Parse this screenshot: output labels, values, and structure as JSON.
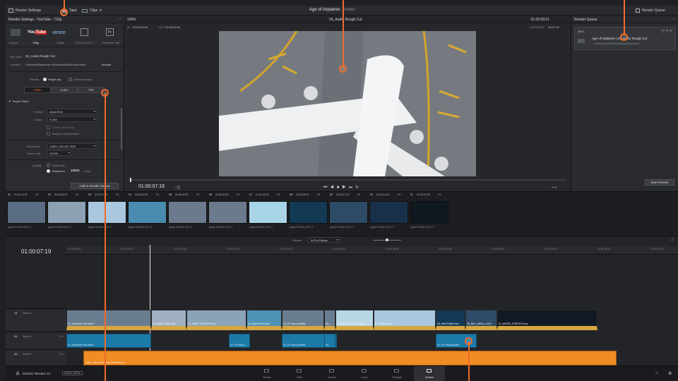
{
  "top": {
    "render_settings": "Render Settings",
    "tape": "Tape",
    "clips": "Clips",
    "project_title": "Age of Airplanes",
    "edited": "Edited",
    "render_queue": "Render Queue"
  },
  "render_settings": {
    "panel_title": "Render Settings - YouTube - 720p",
    "presets": [
      "Custom",
      "720p",
      "1080p",
      "Final Cut Pro 7",
      "Premiere XML"
    ],
    "filename_label": "File name",
    "filename": "04_Audio Rough Cut",
    "location_label": "Location",
    "location": "/Volumes/Macintosh HD/Users/iMac/Documents",
    "browse": "Browse",
    "render_label": "Render",
    "single_clip": "Single clip",
    "individual_clips": "Individual clips",
    "tabs": [
      "Video",
      "Audio",
      "File"
    ],
    "export_video": "Export Video",
    "format_label": "Format",
    "format": "QuickTime",
    "codec_label": "Codec",
    "codec": "H.264",
    "frame_reordering": "Frame reordering",
    "network_optimization": "Network Optimization",
    "resolution_label": "Resolution",
    "resolution": "1280 x 720 HD 720P",
    "frame_rate_label": "Frame rate",
    "frame_rate": "23.976",
    "quality_label": "Quality",
    "automatic": "Automatic",
    "restrict_to": "Restrict to",
    "restrict_value": "10000",
    "restrict_unit": "Kb/s",
    "add_queue": "Add to Render Queue"
  },
  "viewer": {
    "zoom": "100%",
    "in_label": "IN",
    "in_tc": "01:00:03:00",
    "out_label": "OUT",
    "out_tc": "01:00:03:23",
    "clip_title": "04_Audio Rough Cut",
    "tc_right": "01:00:00:01",
    "duration_label": "DURATION",
    "duration": "00:07:19",
    "current_tc": "01:00:07:19"
  },
  "render_queue": {
    "title": "Render Queue",
    "job": "Job 1",
    "job_title": "Age of Airplanes | 04_Audio Rough Cut",
    "job_path": "...es/Macintosh HD/Users/iMac/Documents",
    "start": "Start Render"
  },
  "thumbs": {
    "header": [
      "01",
      "01:01:13:23",
      "V1",
      "02",
      "01:00:00:01",
      "V1",
      "03",
      "01:00:17:01",
      "V1",
      "04",
      "01:00:29:02",
      "V1",
      "05",
      "01:00:49:22",
      "V1",
      "06",
      "01:00:53:18",
      "V1",
      "07",
      "01:01:19:24",
      "V1",
      "08",
      "01:00:38:19",
      "V1",
      "09",
      "01:00:17:12",
      "V1",
      "10",
      "01:00:14:10",
      "V1",
      "11",
      "01:00:01:09",
      "V1"
    ],
    "captions": [
      "Apple ProRes 422 LT",
      "Apple ProRes 422 LT",
      "Apple ProRes 422 LT",
      "Apple ProRes 422 LT",
      "Apple ProRes 422 LT",
      "Apple ProRes 422 LT",
      "Apple ProRes 422 LT",
      "Apple ProRes 422 LT",
      "Apple ProRes 422 LT",
      "Apple ProRes 422 LT",
      "Apple ProRes 422 LT"
    ]
  },
  "timeline": {
    "render_label": "Render",
    "range": "In/Out Range",
    "timecode": "01:00:07:19",
    "ruler": [
      "01:00:00:00",
      "01:00:04:21",
      "01:00:09:18",
      "01:00:14:16",
      "01:00:19:13",
      "01:00:24:11",
      "01:00:29:08",
      "01:00:34:06",
      "01:00:39:03",
      "01:00:44:01",
      "01:00:48:22",
      "01:00:53:19"
    ],
    "video_track": "Video 1",
    "v1": "V1",
    "a1": "A1",
    "a2": "A2",
    "audio1": "Audio 1",
    "audio2": "Audio 2",
    "track_val": "2.0",
    "clips": [
      "01_shoot the real world",
      "02_A380_TAKE.mov",
      "02_A380_TAKEOFF.mov",
      "03_MALDIVES.mov",
      "02_FX was possible",
      "02_...",
      "03_SOUTH_POLE_SCE...",
      "07_KENYA.mov",
      "03_MILKYWAY.mov",
      "05_BAY_AREA_LIGH...",
      "11_MOVIE_CREDITS.mov"
    ],
    "aclips": [
      "01_shoot the real world",
      "02_FX was p...",
      "02_FX was possible",
      "02_...",
      "02_FX was possible"
    ],
    "music": "AGE - bla la to the fun of Airlines.all.."
  },
  "bottom": {
    "app_name": "DaVinci Resolve 12",
    "beta": "PUBLIC BETA",
    "pages": [
      "Media",
      "Edit",
      "Fusion",
      "Color",
      "Fairlight",
      "Deliver"
    ]
  },
  "colors": {
    "accent": "#ee6b2a",
    "audio": "#1c7aa8",
    "music": "#f08c25"
  }
}
